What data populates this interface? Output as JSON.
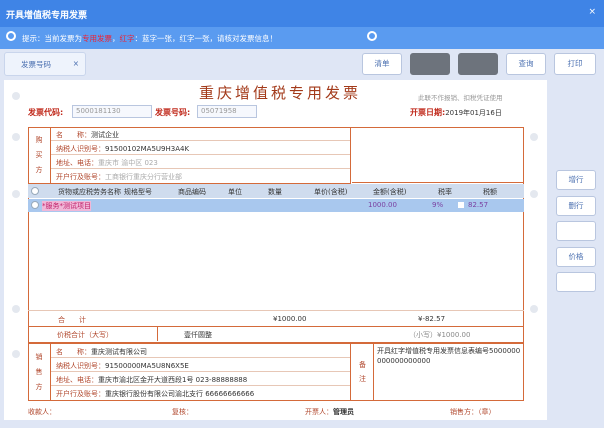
{
  "window": {
    "title": "开具增值税专用发票",
    "close": "×"
  },
  "info": {
    "prefix": "提示：当前发票为",
    "red1": "专用发票",
    "mid": "，",
    "red2": "红字",
    "tail": "：蓝字一张，红字一张，请核对发票信息！"
  },
  "toolbar": {
    "tab": "发票号码",
    "tab_close": "×",
    "buttons": [
      "清单",
      "",
      "",
      "查询",
      "打印"
    ]
  },
  "invoice": {
    "title": "重庆增值税专用发票",
    "top_right": "此联不作报销、扣税凭证使用",
    "code_label": "发票代码:",
    "code_value": "5000181130",
    "number_label": "发票号码:",
    "number_value": "05071958",
    "date_label": "开票日期:",
    "date_value": "2019年01月16日",
    "buyer": {
      "side": [
        "购",
        "买",
        "方"
      ],
      "labels": [
        "名　　称：",
        "纳税人识别号：",
        "地址、电话：",
        "开户行及账号："
      ],
      "values": [
        "测试企业",
        "91500102MA5U9H3A4K",
        "重庆市 渝中区 023",
        "工商银行重庆分行营业部"
      ]
    },
    "columns": [
      "货物或应税劳务名称",
      "规格型号",
      "商品编码",
      "单位",
      "数量",
      "单价(含税)",
      "金额(含税)",
      "税率",
      "税额"
    ],
    "rows": [
      {
        "name": "*服务*测试项目",
        "amount": "1000.00",
        "rate": "9%",
        "tax": "82.57"
      }
    ],
    "total": {
      "label": "合　　计",
      "amount": "¥1000.00",
      "tax": "¥-82.57"
    },
    "grand": {
      "label": "价税合计（大写）",
      "words": "壹仟圆整",
      "small": "（小写）¥1000.00"
    },
    "seller": {
      "side": [
        "销",
        "售",
        "方"
      ],
      "labels": [
        "名　　称：",
        "纳税人识别号：",
        "地址、电话：",
        "开户行及账号："
      ],
      "values": [
        "重庆测试有限公司",
        "91500000MA5U8N6X5E",
        "重庆市渝北区金开大道西段1号 023-88888888",
        "重庆银行股份有限公司渝北支行 66666666666"
      ]
    },
    "remark_label": [
      "备",
      "注"
    ],
    "remark": "开具红字增值税专用发票信息表编号5000000000000000000",
    "footer": {
      "payee": "收款人：",
      "review": "复核：",
      "drawer": "开票人：",
      "drawer_name": "管理员",
      "seller_stamp": "销售方：（章）"
    }
  },
  "side_buttons": [
    "增行",
    "删行",
    "",
    "价格",
    "",
    ""
  ]
}
